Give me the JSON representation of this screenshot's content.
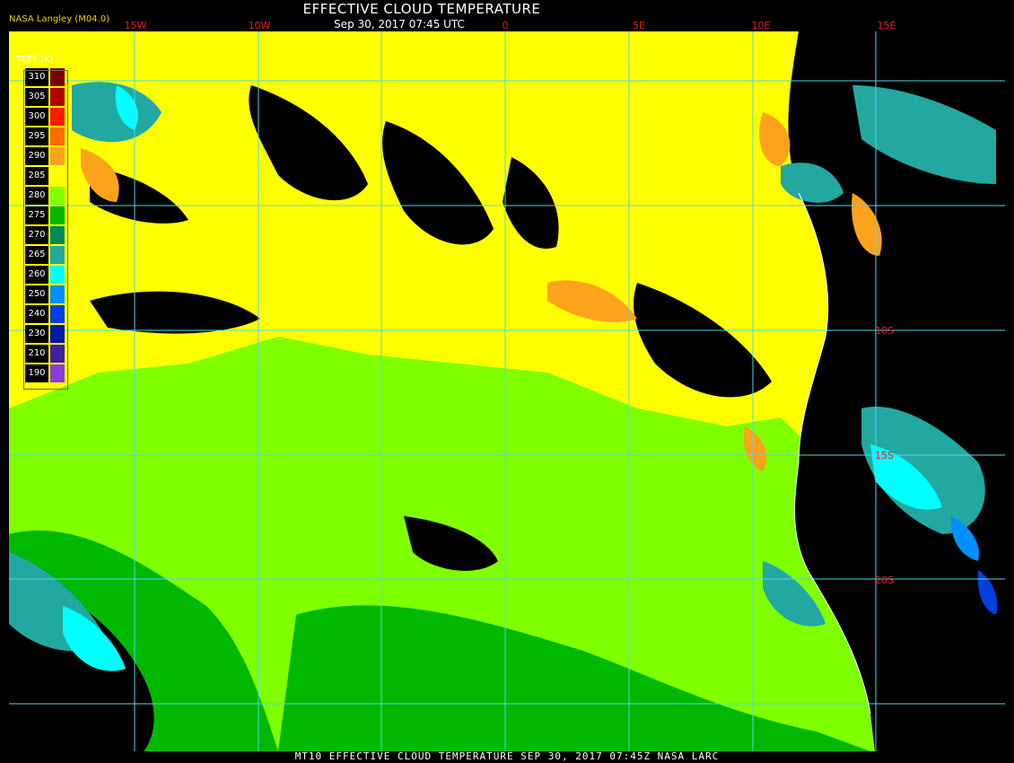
{
  "header": {
    "title": "EFFECTIVE CLOUD TEMPERATURE",
    "date": "Sep 30, 2017 07:45 UTC",
    "brand": "NASA Langley (M04.0)"
  },
  "longitude_labels": [
    "15W",
    "10W",
    "0",
    "5E",
    "10E",
    "15E"
  ],
  "latitude_labels": [
    "10S",
    "15S",
    "20S"
  ],
  "legend": {
    "title": "TEFF (K)",
    "entries": [
      {
        "label": "310",
        "color": "#7a0000"
      },
      {
        "label": "305",
        "color": "#b00000"
      },
      {
        "label": "300",
        "color": "#ff1a00"
      },
      {
        "label": "295",
        "color": "#ff6a00"
      },
      {
        "label": "290",
        "color": "#ffa21c"
      },
      {
        "label": "285",
        "color": "#ffff00"
      },
      {
        "label": "280",
        "color": "#80ff00"
      },
      {
        "label": "275",
        "color": "#00b800"
      },
      {
        "label": "270",
        "color": "#008a5a"
      },
      {
        "label": "265",
        "color": "#22a8a0"
      },
      {
        "label": "260",
        "color": "#00ffff"
      },
      {
        "label": "250",
        "color": "#0090ff"
      },
      {
        "label": "240",
        "color": "#0040e0"
      },
      {
        "label": "230",
        "color": "#0018a8"
      },
      {
        "label": "210",
        "color": "#4020a0"
      },
      {
        "label": "190",
        "color": "#8a3cd8"
      }
    ]
  },
  "footer": "MT10  EFFECTIVE CLOUD TEMPERATURE   SEP 30, 2017 07:45Z   NASA LARC"
}
